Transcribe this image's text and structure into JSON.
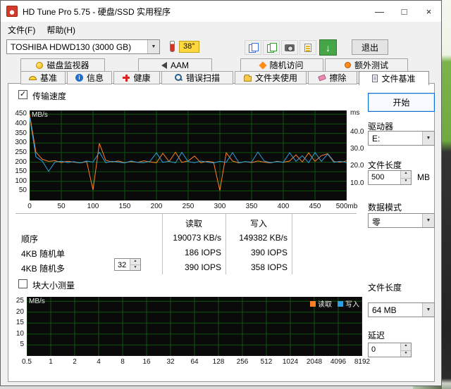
{
  "window": {
    "title": "HD Tune Pro 5.75 - 硬盘/SSD 实用程序",
    "minimize_glyph": "—",
    "maximize_glyph": "□",
    "close_glyph": "×"
  },
  "menu": {
    "file": "文件(F)",
    "help": "帮助(H)"
  },
  "toolbar": {
    "drive": "TOSHIBA HDWD130 (3000 GB)",
    "temperature": "38°",
    "exit": "退出"
  },
  "tabs_row1": [
    {
      "label": "磁盘监视器"
    },
    {
      "label": "AAM"
    },
    {
      "label": "随机访问"
    },
    {
      "label": "额外测试"
    }
  ],
  "tabs_row2": [
    {
      "label": "基准"
    },
    {
      "label": "信息"
    },
    {
      "label": "健康"
    },
    {
      "label": "错误扫描"
    },
    {
      "label": "文件夹使用"
    },
    {
      "label": "擦除"
    },
    {
      "label": "文件基准",
      "active": true
    }
  ],
  "main": {
    "transfer_speed_label": "传输速度",
    "block_size_label": "块大小测量",
    "results_table": {
      "col_read": "读取",
      "col_write": "写入",
      "rows": [
        {
          "label": "顺序",
          "read": "190073 KB/s",
          "write": "149382 KB/s"
        },
        {
          "label": "4KB 随机单",
          "read": "186 IOPS",
          "write": "390 IOPS"
        },
        {
          "label": "4KB 随机多",
          "queue_depth": "32",
          "read": "390 IOPS",
          "write": "358 IOPS"
        }
      ]
    }
  },
  "sidebar": {
    "start": "开始",
    "drive_label": "驱动器",
    "drive_value": "E:",
    "file_length_label": "文件长度",
    "file_length_value": "500",
    "file_length_unit": "MB",
    "data_mode_label": "数据模式",
    "data_mode_value": "零",
    "file_length2_label": "文件长度",
    "file_length2_value": "64 MB",
    "delay_label": "延迟",
    "delay_value": "0"
  },
  "chart_data": [
    {
      "type": "line",
      "name": "transfer-speed-benchmark",
      "x_max": 500,
      "x_step": 10,
      "x_ticks": [
        "0",
        "50",
        "100",
        "150",
        "200",
        "250",
        "300",
        "350",
        "400",
        "450",
        "500mb"
      ],
      "y_left_unit": "MB/s",
      "y_left_ticks": [
        450,
        400,
        350,
        300,
        250,
        200,
        150,
        100,
        50
      ],
      "y_left_max": 470,
      "y_right_unit": "ms",
      "y_right_ticks": [
        40,
        30,
        20,
        10
      ],
      "y_right_max": 52.5,
      "grid_color": "#0d540d",
      "bg": "#0a0a0a",
      "series": [
        {
          "name": "读取",
          "color": "#ff7f27",
          "values": [
            450,
            252,
            215,
            204,
            208,
            198,
            205,
            200,
            196,
            203,
            55,
            298,
            210,
            201,
            206,
            197,
            203,
            199,
            207,
            201,
            197,
            246,
            203,
            252,
            199,
            206,
            232,
            197,
            204,
            200,
            52,
            249,
            206,
            196,
            203,
            198,
            206,
            200,
            196,
            205,
            199,
            206,
            238,
            201,
            249,
            204,
            234,
            244,
            203,
            199,
            207
          ]
        },
        {
          "name": "写入",
          "color": "#2f9fe0",
          "values": [
            436,
            228,
            206,
            152,
            201,
            205,
            198,
            203,
            196,
            206,
            200,
            252,
            197,
            204,
            200,
            196,
            206,
            199,
            197,
            205,
            249,
            199,
            204,
            196,
            251,
            203,
            197,
            206,
            200,
            196,
            204,
            199,
            250,
            197,
            203,
            200,
            253,
            206,
            197,
            203,
            199,
            249,
            204,
            234,
            197,
            251,
            204,
            242,
            199,
            205,
            197
          ]
        }
      ]
    },
    {
      "type": "line",
      "name": "block-size-benchmark",
      "categories": [
        "0.5",
        "1",
        "2",
        "4",
        "8",
        "16",
        "32",
        "64",
        "128",
        "256",
        "512",
        "1024",
        "2048",
        "4096",
        "8192"
      ],
      "y_unit": "MB/s",
      "y_ticks": [
        25,
        20,
        15,
        10,
        5
      ],
      "y_max": 27,
      "grid_color": "#0d540d",
      "bg": "#0a0a0a",
      "legend": [
        {
          "name": "读取",
          "color": "#ff7f27"
        },
        {
          "name": "写入",
          "color": "#2f9fe0"
        }
      ],
      "series": []
    }
  ]
}
